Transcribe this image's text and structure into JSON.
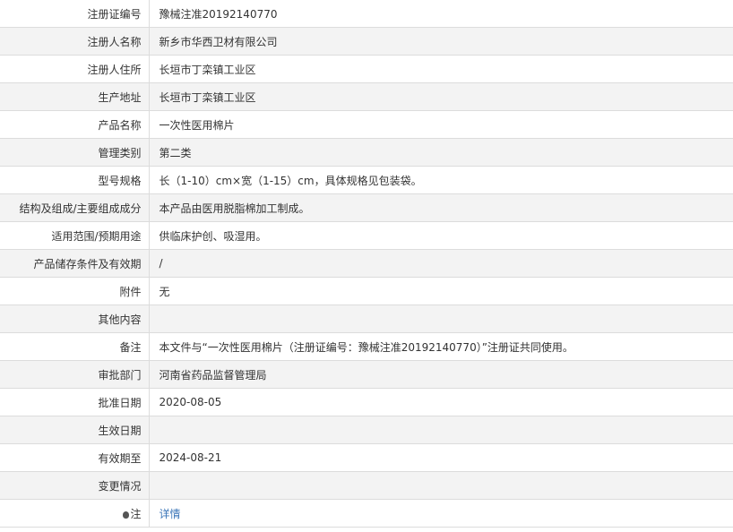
{
  "rows": [
    {
      "label": "注册证编号",
      "value": "豫械注准20192140770"
    },
    {
      "label": "注册人名称",
      "value": "新乡市华西卫材有限公司"
    },
    {
      "label": "注册人住所",
      "value": "长垣市丁栾镇工业区"
    },
    {
      "label": "生产地址",
      "value": "长垣市丁栾镇工业区"
    },
    {
      "label": "产品名称",
      "value": "一次性医用棉片"
    },
    {
      "label": "管理类别",
      "value": "第二类"
    },
    {
      "label": "型号规格",
      "value": "长（1-10）cm×宽（1-15）cm，具体规格见包装袋。"
    },
    {
      "label": "结构及组成/主要组成成分",
      "value": "本产品由医用脱脂棉加工制成。"
    },
    {
      "label": "适用范围/预期用途",
      "value": "供临床护创、吸湿用。"
    },
    {
      "label": "产品储存条件及有效期",
      "value": "/"
    },
    {
      "label": "附件",
      "value": "无"
    },
    {
      "label": "其他内容",
      "value": ""
    },
    {
      "label": "备注",
      "value": "本文件与“一次性医用棉片（注册证编号：豫械注准20192140770）”注册证共同使用。"
    },
    {
      "label": "审批部门",
      "value": "河南省药品监督管理局"
    },
    {
      "label": "批准日期",
      "value": "2020-08-05"
    },
    {
      "label": "生效日期",
      "value": ""
    },
    {
      "label": "有效期至",
      "value": "2024-08-21"
    },
    {
      "label": "变更情况",
      "value": ""
    }
  ],
  "note_row": {
    "label": "注",
    "icon": "bulb-icon",
    "link_text": "详情"
  }
}
